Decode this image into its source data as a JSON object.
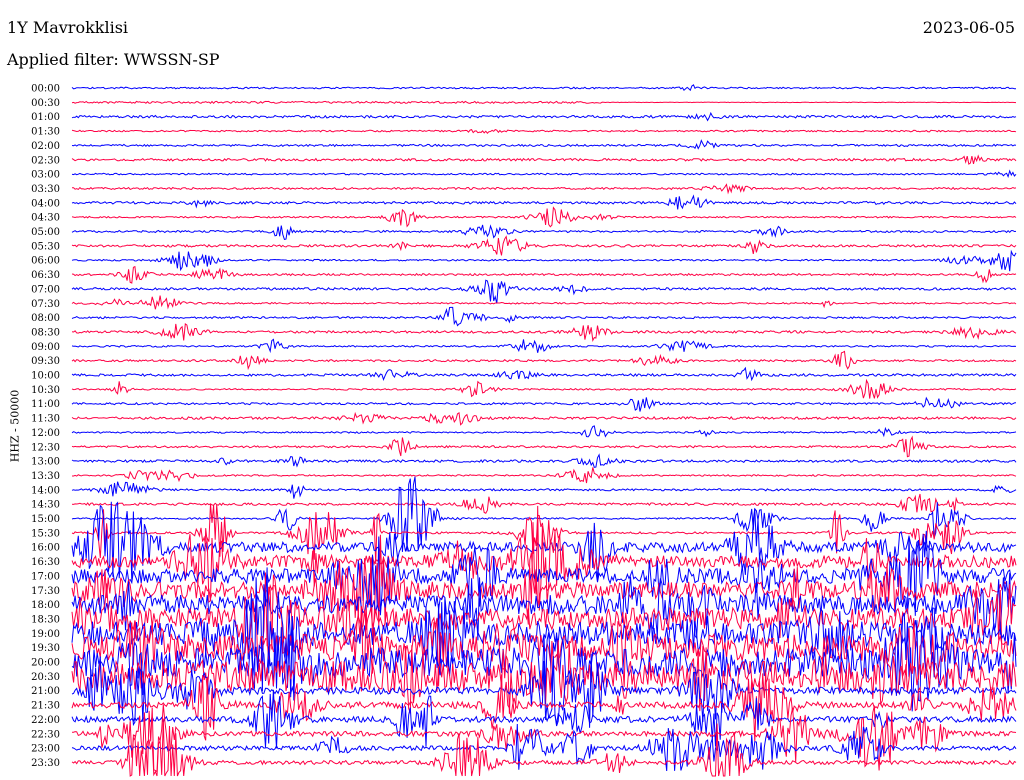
{
  "chart_data": {
    "type": "line",
    "title": "1Y Mavrokklisi",
    "date": "2023-06-05",
    "subtitle": "Applied filter: WWSSN-SP",
    "ylabel": "HHZ - 50000",
    "row_labels": [
      "00:00",
      "00:30",
      "01:00",
      "01:30",
      "02:00",
      "02:30",
      "03:00",
      "03:30",
      "04:00",
      "04:30",
      "05:00",
      "05:30",
      "06:00",
      "06:30",
      "07:00",
      "07:30",
      "08:00",
      "08:30",
      "09:00",
      "09:30",
      "10:00",
      "10:30",
      "11:00",
      "11:30",
      "12:00",
      "12:30",
      "13:00",
      "13:30",
      "14:00",
      "14:30",
      "15:00",
      "15:30",
      "16:00",
      "16:30",
      "17:00",
      "17:30",
      "18:00",
      "18:30",
      "19:00",
      "19:30",
      "20:00",
      "20:30",
      "21:00",
      "21:30",
      "22:00",
      "22:30",
      "23:00",
      "23:30"
    ],
    "row_colors": [
      "#0000ff",
      "#ff0044"
    ],
    "row_minutes": 30,
    "partial_row": {
      "row": "00:30",
      "end_fraction": 0.56
    },
    "grid": false,
    "legend": "none"
  }
}
